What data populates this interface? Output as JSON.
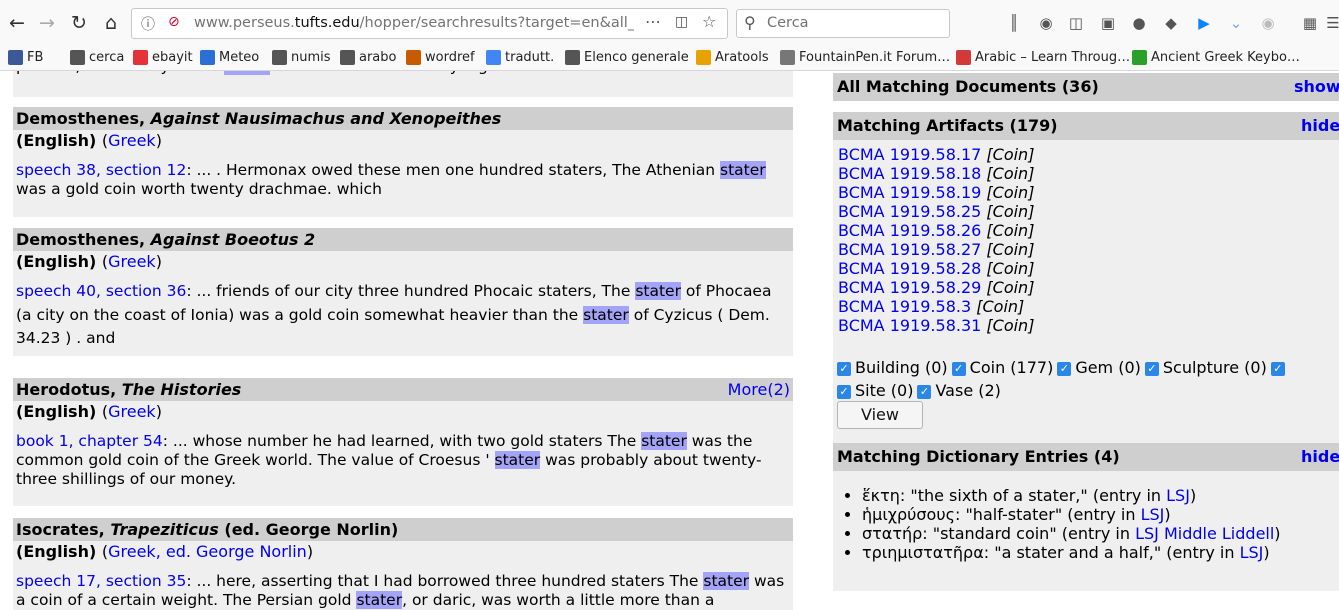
{
  "browser": {
    "url_host": "www.perseus.",
    "url_domain": "tufts.edu",
    "url_path": "/hopper/searchresults?target=en&all_words=st",
    "search_placeholder": "Cerca",
    "bookmarks": [
      {
        "label": "FB",
        "icon": "facebook-icon",
        "color": "#3b5998"
      },
      {
        "label": "cerca",
        "icon": "globe-icon",
        "color": "#555555"
      },
      {
        "label": "ebayit",
        "icon": "ebay-icon",
        "color": "#e53238"
      },
      {
        "label": "Meteo",
        "icon": "meteo-icon",
        "color": "#2a6fd6"
      },
      {
        "label": "numis",
        "icon": "folder-icon",
        "color": "#555555"
      },
      {
        "label": "arabo",
        "icon": "folder-icon",
        "color": "#555555"
      },
      {
        "label": "wordref",
        "icon": "wordreference-icon",
        "color": "#c85a00"
      },
      {
        "label": "tradutt.",
        "icon": "translate-icon",
        "color": "#4285f4"
      },
      {
        "label": "Elenco generale",
        "icon": "globe-icon",
        "color": "#555555"
      },
      {
        "label": "Aratools",
        "icon": "lambda-icon",
        "color": "#e8a200"
      },
      {
        "label": "FountainPen.it Forum…",
        "icon": "pen-icon",
        "color": "#777777"
      },
      {
        "label": "Arabic – Learn Throug…",
        "icon": "arabic-site-icon",
        "color": "#d23a3a"
      },
      {
        "label": "Ancient Greek Keybo…",
        "icon": "l-icon",
        "color": "#2aa02a"
      }
    ]
  },
  "results": [
    {
      "author": "",
      "title": "",
      "fragment": "percent, and the Cyzicene |stater| was worth there twenty-eight Attic drachmae."
    },
    {
      "author": "Demosthenes,",
      "title": "Against Nausimachus and Xenopeithes",
      "extra": "",
      "more": "",
      "lang": "(English)",
      "lang_link": "Greek",
      "ref": "speech 38, section 12",
      "parts": [
        ": ... . Hermonax owed these men one hundred staters, The Athenian ",
        "stater",
        " was a gold coin worth twenty drachmae. which"
      ]
    },
    {
      "author": "Demosthenes,",
      "title": "Against Boeotus 2",
      "extra": "",
      "more": "",
      "lang": "(English)",
      "lang_link": "Greek",
      "ref": "speech 40, section 36",
      "parts": [
        ": ... friends of our city three hundred Phocaic staters, The ",
        "stater",
        " of Phocaea   (a city on the coast of Ionia)   was a gold coin somewhat heavier than the ",
        "stater",
        " of Cyzicus   ( Dem. 34.23 )  . and"
      ]
    },
    {
      "author": "Herodotus,",
      "title": "The Histories",
      "extra": "",
      "more": "More(2)",
      "lang": "(English)",
      "lang_link": "Greek",
      "ref": "book 1, chapter 54",
      "parts": [
        ": ... whose number he had learned, with two gold staters The ",
        "stater",
        " was the common gold coin of the Greek world. The value of Croesus ' ",
        "stater",
        " was probably about twenty-three shillings of our money."
      ]
    },
    {
      "author": "Isocrates,",
      "title": "Trapeziticus",
      "extra": "(ed. George Norlin)",
      "more": "",
      "lang": "(English)",
      "lang_link": "Greek, ed. George Norlin",
      "ref": "speech 17, section 35",
      "parts": [
        ": ... here, asserting that I had borrowed three hundred staters The ",
        "stater",
        " was a coin of a certain weight. The Persian gold ",
        "stater",
        ", or daric, was worth a little more than a"
      ]
    }
  ],
  "panel": {
    "all_docs": {
      "title": "All Matching Documents (36)",
      "toggle": "show"
    },
    "artifacts": {
      "title": "Matching Artifacts (179)",
      "toggle": "hide",
      "items": [
        {
          "id": "BCMA 1919.58.17",
          "type": "[Coin]"
        },
        {
          "id": "BCMA 1919.58.18",
          "type": "[Coin]"
        },
        {
          "id": "BCMA 1919.58.19",
          "type": "[Coin]"
        },
        {
          "id": "BCMA 1919.58.25",
          "type": "[Coin]"
        },
        {
          "id": "BCMA 1919.58.26",
          "type": "[Coin]"
        },
        {
          "id": "BCMA 1919.58.27",
          "type": "[Coin]"
        },
        {
          "id": "BCMA 1919.58.28",
          "type": "[Coin]"
        },
        {
          "id": "BCMA 1919.58.29",
          "type": "[Coin]"
        },
        {
          "id": "BCMA 1919.58.3",
          "type": "[Coin]"
        },
        {
          "id": "BCMA 1919.58.31",
          "type": "[Coin]"
        }
      ],
      "filters": [
        "Building (0)",
        "Coin (177)",
        "Gem (0)",
        "Sculpture (0)",
        "Site (0)",
        "Vase (2)"
      ],
      "view_label": "View"
    },
    "dictionary": {
      "title": "Matching Dictionary Entries (4)",
      "toggle": "hide",
      "entries": [
        {
          "term": "ἕκτη",
          "gloss": ": \"the sixth of a stater,\" (entry in ",
          "links": [
            "LSJ"
          ],
          "close": ")"
        },
        {
          "term": "ἡμιχρύσους",
          "gloss": ": \"half-stater\" (entry in ",
          "links": [
            "LSJ"
          ],
          "close": ")"
        },
        {
          "term": "στατήρ",
          "gloss": ": \"standard coin\" (entry in ",
          "links": [
            "LSJ",
            "Middle Liddell"
          ],
          "close": ")"
        },
        {
          "term": "τριημιστατῆρα",
          "gloss": ": \"a stater and a half,\" (entry in ",
          "links": [
            "LSJ"
          ],
          "close": ")"
        }
      ]
    }
  }
}
